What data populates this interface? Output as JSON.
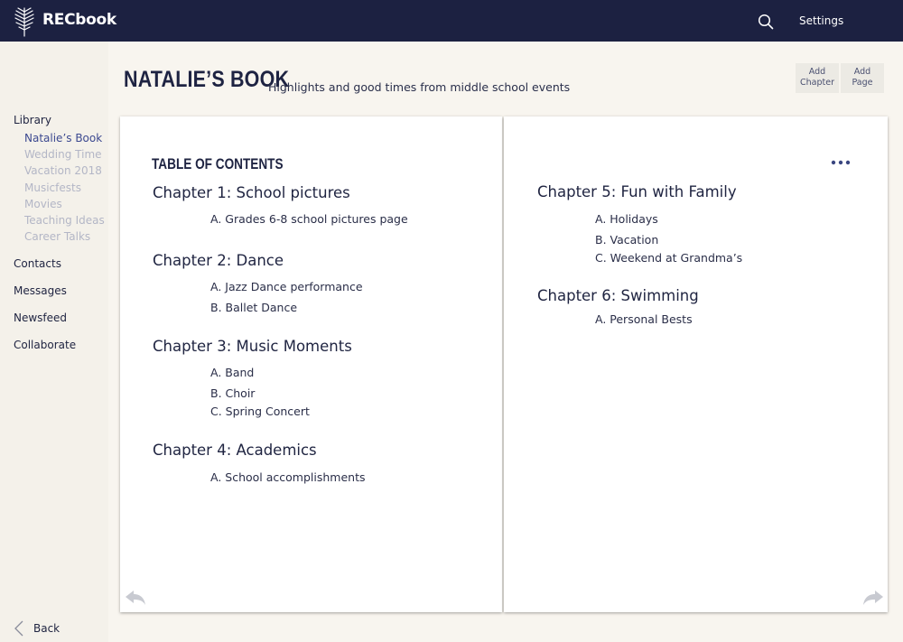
{
  "app": {
    "name": "RECbook",
    "logo_icon": "feather-icon",
    "search_icon": "search-icon",
    "settings_label": "Settings",
    "brand_color": "#1c2141"
  },
  "sidebar": {
    "library_label": "Library",
    "books": [
      {
        "label": "Natalie’s Book",
        "active": true
      },
      {
        "label": "Wedding Time",
        "active": false
      },
      {
        "label": "Vacation 2018",
        "active": false
      },
      {
        "label": "Musicfests",
        "active": false
      },
      {
        "label": "Movies",
        "active": false
      },
      {
        "label": "Teaching Ideas",
        "active": false
      },
      {
        "label": "Career Talks",
        "active": false
      }
    ],
    "items": [
      {
        "label": "Contacts"
      },
      {
        "label": "Messages"
      },
      {
        "label": "Newsfeed"
      },
      {
        "label": "Collaborate"
      }
    ],
    "back_label": "Back"
  },
  "header": {
    "title": "NATALIE’S BOOK",
    "subtitle": "Highlights and good times from middle school events",
    "add_chapter_line1": "Add",
    "add_chapter_line2": "Chapter",
    "add_page_line1": "Add",
    "add_page_line2": "Page"
  },
  "book": {
    "toc_title": "TABLE OF CONTENTS",
    "left_chapters": [
      {
        "title": "Chapter 1: School pictures",
        "sections": [
          "A. Grades 6-8 school pictures page"
        ]
      },
      {
        "title": "Chapter 2: Dance",
        "sections": [
          "A. Jazz Dance performance",
          "B. Ballet Dance"
        ]
      },
      {
        "title": "Chapter 3: Music Moments",
        "sections": [
          "A. Band",
          "B. Choir",
          "C. Spring Concert"
        ]
      },
      {
        "title": "Chapter 4: Academics",
        "sections": [
          "A. School accomplishments"
        ]
      }
    ],
    "right_chapters": [
      {
        "title": "Chapter 5: Fun with Family",
        "sections": [
          "A. Holidays",
          "B. Vacation",
          "C. Weekend at Grandma’s"
        ]
      },
      {
        "title": "Chapter 6: Swimming",
        "sections": [
          "A.  Personal Bests"
        ]
      }
    ],
    "more_icon": "more-dots-icon",
    "prev_icon": "arrow-back-icon",
    "next_icon": "arrow-forward-icon"
  }
}
